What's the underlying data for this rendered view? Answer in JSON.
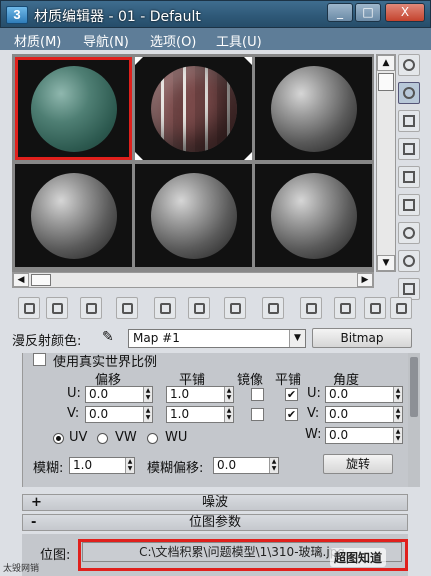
{
  "window": {
    "icon_label": "3",
    "title": "材质编辑器 - 01 - Default",
    "minimize_label": "_",
    "maximize_label": "□",
    "close_label": "X"
  },
  "menu": [
    "材质(M)",
    "导航(N)",
    "选项(O)",
    "工具(U)"
  ],
  "slots": [
    {
      "type": "green",
      "selected": true
    },
    {
      "type": "brown",
      "selected": false
    },
    {
      "type": "gray",
      "selected": false
    },
    {
      "type": "gray",
      "selected": false
    },
    {
      "type": "gray",
      "selected": false
    },
    {
      "type": "gray",
      "selected": false
    }
  ],
  "diffuse": {
    "label": "漫反射颜色:",
    "map_value": "Map #1",
    "type_button": "Bitmap"
  },
  "coords": {
    "real_world_label": "使用真实世界比例",
    "headers": {
      "offset": "偏移",
      "tiling": "平铺",
      "mirror": "镜像",
      "tile": "平铺",
      "angle": "角度"
    },
    "u_label": "U:",
    "v_label": "V:",
    "w_label": "W:",
    "u_offset": "0.0",
    "v_offset": "0.0",
    "u_tiling": "1.0",
    "v_tiling": "1.0",
    "u_angle": "0.0",
    "v_angle": "0.0",
    "w_angle": "0.0",
    "uv_label": "UV",
    "vw_label": "VW",
    "wu_label": "WU",
    "blur_label": "模糊:",
    "blur_value": "1.0",
    "blur_offset_label": "模糊偏移:",
    "blur_offset_value": "0.0",
    "rotate_button": "旋转"
  },
  "rollouts": {
    "noise": {
      "sign": "+",
      "label": "噪波"
    },
    "bitmap_params": {
      "sign": "-",
      "label": "位图参数"
    }
  },
  "bitmap": {
    "label": "位图:",
    "path": "C:\\文档积累\\问题模型\\1\\310-玻璃.jpg"
  },
  "watermark": "超图知道",
  "brand": "太毁网销"
}
